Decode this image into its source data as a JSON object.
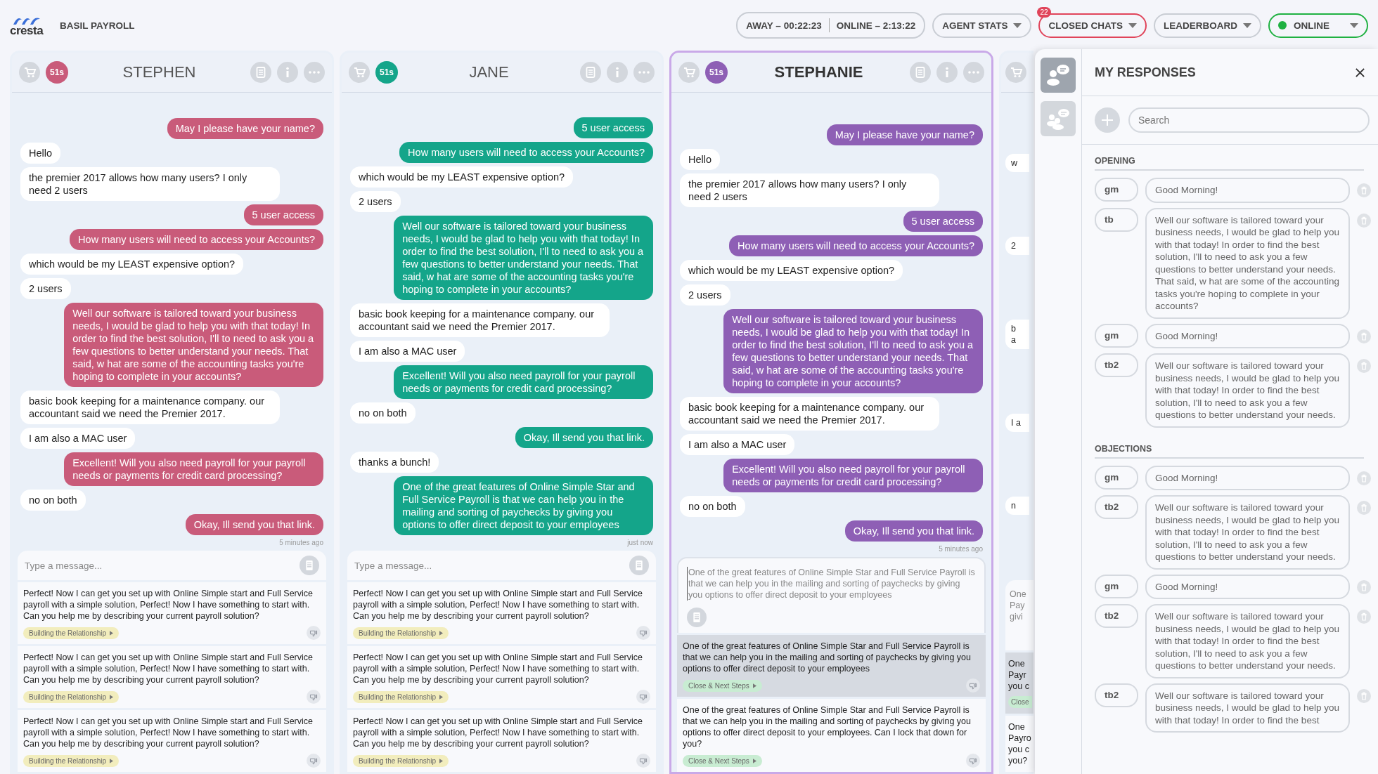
{
  "app": {
    "brand": "cresta",
    "account": "BASIL PAYROLL"
  },
  "toolbar": {
    "away": "AWAY – 00:22:23",
    "online": "ONLINE – 2:13:22",
    "menus": [
      {
        "label": "AGENT STATS",
        "alert": false
      },
      {
        "label": "CLOSED CHATS",
        "alert": true,
        "badge": "22"
      },
      {
        "label": "LEADERBOARD",
        "alert": false
      }
    ],
    "status": {
      "label": "ONLINE",
      "color": "#1fb141"
    }
  },
  "chats": [
    {
      "name": "STEPHEN",
      "timer": "51s",
      "color": "#c95b7a",
      "selected": false,
      "messages": [
        {
          "kind": "agent",
          "text": "May I please have your name?"
        },
        {
          "kind": "customer",
          "text": "Hello"
        },
        {
          "kind": "customer",
          "text": "the premier 2017 allows how many users? I only need 2 users"
        },
        {
          "kind": "agent",
          "text": "5 user access"
        },
        {
          "kind": "agent",
          "text": "How many users will need to access your Accounts?"
        },
        {
          "kind": "customer",
          "text": "which would be my LEAST expensive option?"
        },
        {
          "kind": "customer",
          "text": "2 users"
        },
        {
          "kind": "agent",
          "text": "Well our software is tailored toward your business needs, I would be glad to help you with that today! In order to find the best solution, I'll to need to ask you a few questions to better understand your needs. That said, w hat are some of the accounting tasks you're hoping to complete in your accounts?"
        },
        {
          "kind": "customer",
          "text": "basic book keeping for a maintenance company. our accountant said we need the Premier 2017."
        },
        {
          "kind": "customer",
          "text": "I am also a MAC user"
        },
        {
          "kind": "agent",
          "text": "Excellent! Will you also need payroll for your payroll needs or payments for credit card processing?"
        },
        {
          "kind": "customer",
          "text": "no on both"
        },
        {
          "kind": "agent",
          "text": "Okay, Ill send you that link."
        }
      ],
      "time": "5 minutes ago",
      "composer": {
        "placeholder": "Type a message..."
      },
      "suggestions": [
        {
          "text": "Perfect! Now I can get you set up with Online Simple start and Full Service payroll with a simple solution, Perfect! Now I have something to start with. Can you help me by describing your current payroll solution?",
          "tag": {
            "label": "Building the Relationship",
            "color": "#f2edbd"
          },
          "selected": false
        },
        {
          "text": "Perfect! Now I can get you set up with Online Simple start and Full Service payroll with a simple solution, Perfect! Now I have something to start with. Can you help me by describing your current payroll solution?",
          "tag": {
            "label": "Building the Relationship",
            "color": "#f2edbd"
          },
          "selected": false
        },
        {
          "text": "Perfect! Now I can get you set up with Online Simple start and Full Service payroll with a simple solution, Perfect! Now I have something to start with. Can you help me by describing your current payroll solution?",
          "tag": {
            "label": "Building the Relationship",
            "color": "#f2edbd"
          },
          "selected": false
        }
      ]
    },
    {
      "name": "JANE",
      "timer": "51s",
      "color": "#14a58a",
      "selected": false,
      "messages": [
        {
          "kind": "agent",
          "text": "5 user access"
        },
        {
          "kind": "agent",
          "text": "How many users will need to access your Accounts?"
        },
        {
          "kind": "customer",
          "text": "which would be my LEAST expensive option?"
        },
        {
          "kind": "customer",
          "text": "2 users"
        },
        {
          "kind": "agent",
          "text": "Well our software is tailored toward your business needs, I would be glad to help you with that today! In order to find the best solution, I'll to need to ask you a few questions to better understand your needs. That said, w hat are some of the accounting tasks you're hoping to complete in your accounts?"
        },
        {
          "kind": "customer",
          "text": "basic book keeping for a maintenance company. our accountant said we need the Premier 2017."
        },
        {
          "kind": "customer",
          "text": "I am also a MAC user"
        },
        {
          "kind": "agent",
          "text": "Excellent! Will you also need payroll for your payroll needs or payments for credit card processing?"
        },
        {
          "kind": "customer",
          "text": "no on both"
        },
        {
          "kind": "agent",
          "text": "Okay, Ill send you that link."
        },
        {
          "kind": "customer",
          "text": "thanks a bunch!"
        },
        {
          "kind": "agent",
          "text": "One of the great features of Online Simple Star and Full Service Payroll is that we can help you in the mailing and sorting of paychecks by giving you options to offer direct deposit to your employees"
        }
      ],
      "time": "just now",
      "composer": {
        "placeholder": "Type a message..."
      },
      "suggestions": [
        {
          "text": "Perfect! Now I can get you set up with Online Simple start and Full Service payroll with a simple solution, Perfect! Now I have something to start with. Can you help me by describing your current payroll solution?",
          "tag": {
            "label": "Building the Relationship",
            "color": "#f2edbd"
          },
          "selected": false
        },
        {
          "text": "Perfect! Now I can get you set up with Online Simple start and Full Service payroll with a simple solution, Perfect! Now I have something to start with. Can you help me by describing your current payroll solution?",
          "tag": {
            "label": "Building the Relationship",
            "color": "#f2edbd"
          },
          "selected": false
        },
        {
          "text": "Perfect! Now I can get you set up with Online Simple start and Full Service payroll with a simple solution, Perfect! Now I have something to start with. Can you help me by describing your current payroll solution?",
          "tag": {
            "label": "Building the Relationship",
            "color": "#f2edbd"
          },
          "selected": false
        }
      ]
    },
    {
      "name": "STEPHANIE",
      "timer": "51s",
      "color": "#8e5fb5",
      "selected": true,
      "messages": [
        {
          "kind": "agent",
          "text": "May I please have your name?"
        },
        {
          "kind": "customer",
          "text": "Hello"
        },
        {
          "kind": "customer",
          "text": "the premier 2017 allows how many users? I only need 2 users"
        },
        {
          "kind": "agent",
          "text": "5 user access"
        },
        {
          "kind": "agent",
          "text": "How many users will need to access your Accounts?"
        },
        {
          "kind": "customer",
          "text": "which would be my LEAST expensive option?"
        },
        {
          "kind": "customer",
          "text": "2 users"
        },
        {
          "kind": "agent",
          "text": "Well our software is tailored toward your business needs, I would be glad to help you with that today! In order to find the best solution, I'll to need to ask you a few questions to better understand your needs. That said, w hat are some of the accounting tasks you're hoping to complete in your accounts?"
        },
        {
          "kind": "customer",
          "text": "basic book keeping for a maintenance company. our accountant said we need the Premier 2017."
        },
        {
          "kind": "customer",
          "text": "I am also a MAC user"
        },
        {
          "kind": "agent",
          "text": "Excellent! Will you also need payroll for your payroll needs or payments for credit card processing?"
        },
        {
          "kind": "customer",
          "text": "no on both"
        },
        {
          "kind": "agent",
          "text": "Okay, Ill send you that link."
        }
      ],
      "time": "5 minutes ago",
      "composer": {
        "value": "One of the great features of Online Simple Star and Full Service Payroll is that we can help you in the mailing and sorting of paychecks by giving you options to offer direct deposit to your employees"
      },
      "suggestions": [
        {
          "text": "One of the great features of Online Simple Star and Full Service Payroll is that we can help you in the mailing and sorting of paychecks by giving you options to offer direct deposit to your employees",
          "tag": {
            "label": "Close & Next Steps",
            "color": "#c8ecd2"
          },
          "selected": true
        },
        {
          "text": "One of the great features of Online Simple Star and Full Service Payroll is that we can help you in the mailing and sorting of paychecks by giving you options to offer direct deposit to your employees. Can I lock that down for you?",
          "tag": {
            "label": "Close & Next Steps",
            "color": "#c8ecd2"
          },
          "selected": false
        }
      ]
    }
  ],
  "hidden_chat": {
    "messages": [
      {
        "lines": [
          "w"
        ]
      },
      {
        "lines": [
          "2"
        ]
      },
      {
        "lines": [
          "b",
          "a"
        ]
      },
      {
        "lines": [
          "I a"
        ]
      },
      {
        "lines": [
          "n"
        ]
      }
    ],
    "draft_lines": [
      "One",
      "Pay",
      "givi"
    ],
    "suggestions": [
      {
        "lines": [
          "One",
          "Payr",
          "you c"
        ],
        "tag": "Close",
        "selected": true
      },
      {
        "lines": [
          "One",
          "Payro",
          "you c",
          "you?"
        ],
        "selected": false
      }
    ]
  },
  "responses": {
    "title": "MY RESPONSES",
    "rail": [
      {
        "kind": "personal",
        "selected": true
      },
      {
        "kind": "team",
        "selected": false
      }
    ],
    "search": {
      "placeholder": "Search"
    },
    "sections": [
      {
        "title": "OPENING",
        "items": [
          {
            "shortcut": "gm",
            "text": "Good Morning!"
          },
          {
            "shortcut": "tb",
            "text": "Well our software is tailored toward your business needs, I would be glad to help you with that today! In order to find the best solution, I'll to need to ask you a few questions to better understand your needs. That said, w hat are some of the accounting tasks you're hoping to complete in your accounts?"
          },
          {
            "shortcut": "gm",
            "text": "Good Morning!"
          },
          {
            "shortcut": "tb2",
            "text": "Well our software is tailored toward your business needs, I would be glad to help you with that today! In order to find the best solution, I'll to need to ask you a few questions to better understand your needs."
          }
        ]
      },
      {
        "title": "OBJECTIONS",
        "items": [
          {
            "shortcut": "gm",
            "text": "Good Morning!"
          },
          {
            "shortcut": "tb2",
            "text": "Well our software is tailored toward your business needs, I would be glad to help you with that today! In order to find the best solution, I'll to need to ask you a few questions to better understand your needs."
          },
          {
            "shortcut": "gm",
            "text": "Good Morning!"
          },
          {
            "shortcut": "tb2",
            "text": "Well our software is tailored toward your business needs, I would be glad to help you with that today! In order to find the best solution, I'll to need to ask you a few questions to better understand your needs."
          },
          {
            "shortcut": "tb2",
            "text": "Well our software is tailored toward your business needs, I would be glad to help you with that today! In order to find the best"
          }
        ]
      }
    ]
  }
}
